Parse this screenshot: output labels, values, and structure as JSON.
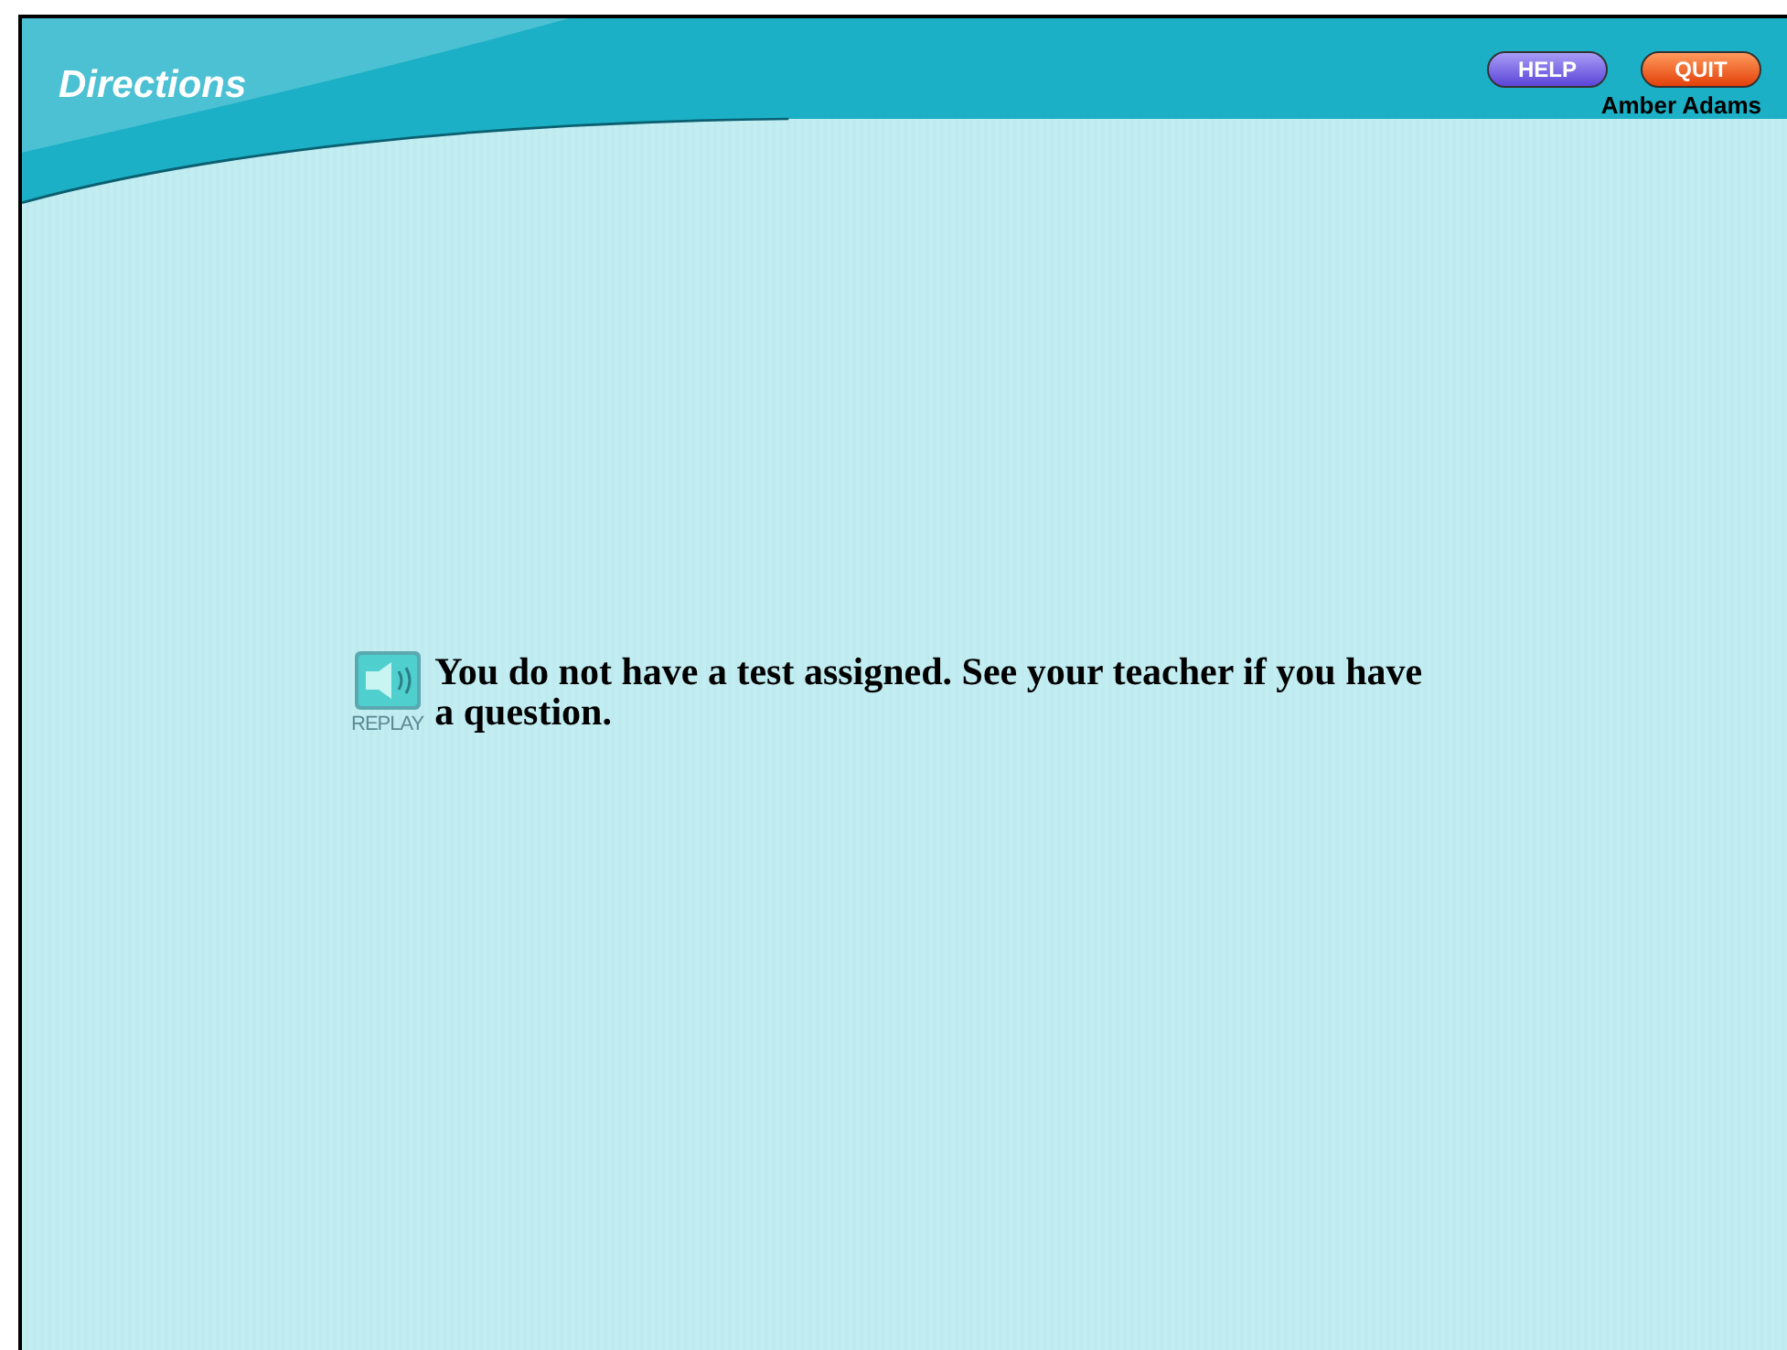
{
  "header": {
    "title": "Directions",
    "buttons": [
      {
        "label": "HELP",
        "kind": "help"
      },
      {
        "label": "QUIT",
        "kind": "quit"
      }
    ],
    "user": "Amber Adams"
  },
  "message": {
    "replay_label": "REPLAY",
    "text": "You do not have a test assigned. See your teacher if you have a question."
  }
}
